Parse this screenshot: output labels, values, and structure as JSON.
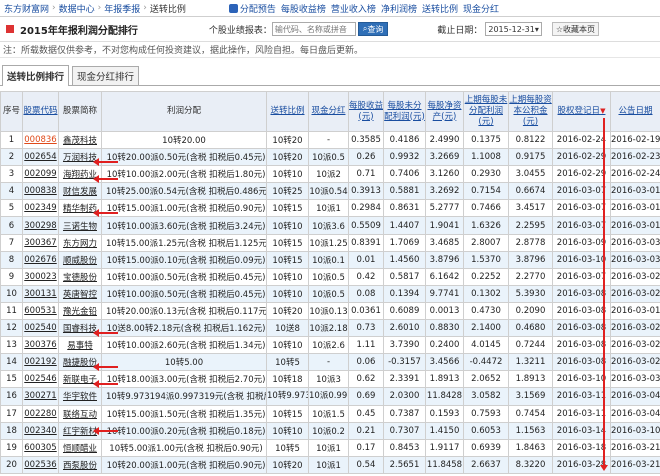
{
  "topnav": {
    "crumbs": [
      "东方财富网",
      "数据中心",
      "年报季报",
      "送转比例"
    ],
    "links": [
      "分配预告",
      "每股收益榜",
      "营业收入榜",
      "净利润榜",
      "送转比例",
      "现金分红"
    ]
  },
  "titlebar": {
    "title": "2015年年报利润分配排行",
    "query_label": "个股业绩报表：",
    "query_placeholder": "输代码、名称或拼音",
    "query_button": "查询",
    "date_label": "截止日期：",
    "date_value": "2015-12-31",
    "favorite": "收藏本页"
  },
  "notice": "注：所载数据仅供参考，不对您构成任何投资建议，据此操作，风险自担。每日盘后更新。",
  "tabs": [
    "送转比例排行",
    "现金分红排行"
  ],
  "table": {
    "headers": [
      "序号",
      "股票代码",
      "股票简称",
      "利润分配",
      "送转比例",
      "现金分红",
      "每股收益(元)",
      "每股未分配利润(元)",
      "每股净资产(元)",
      "上期每股未分配利润(元)",
      "上期每股资本公积金(元)",
      "股权登记日",
      "公告日期"
    ],
    "rows": [
      [
        "1",
        "000836",
        "鑫茂科技",
        "10转20.00",
        "10转20",
        "-",
        "0.3585",
        "0.4186",
        "2.4990",
        "0.1375",
        "0.8122",
        "2016-02-24",
        "2016-02-19"
      ],
      [
        "2",
        "002654",
        "万润科技",
        "10转20.00派0.50元(含税 扣税后0.45元)",
        "10转20",
        "10派0.5",
        "0.26",
        "0.9932",
        "3.2669",
        "1.1008",
        "0.9175",
        "2016-02-29",
        "2016-02-23"
      ],
      [
        "3",
        "002099",
        "海翔药业",
        "10转10.00派2.00元(含税 扣税后1.80元)",
        "10转10",
        "10派2",
        "0.71",
        "0.7406",
        "3.1260",
        "0.2930",
        "3.0455",
        "2016-02-29",
        "2016-02-24"
      ],
      [
        "4",
        "000838",
        "财信发展",
        "10转25.00派0.54元(含税 扣税后0.486元)",
        "10转25",
        "10派0.54",
        "0.3913",
        "0.5881",
        "3.2692",
        "0.7154",
        "0.6674",
        "2016-03-07",
        "2016-03-01"
      ],
      [
        "5",
        "002349",
        "精华制药",
        "10转15.00派1.00元(含税 扣税后0.90元)",
        "10转15",
        "10派1",
        "0.2984",
        "0.8631",
        "5.2777",
        "0.7466",
        "3.4517",
        "2016-03-07",
        "2016-03-01"
      ],
      [
        "6",
        "300298",
        "三诺生物",
        "10转10.00派3.60元(含税 扣税后3.24元)",
        "10转10",
        "10派3.6",
        "0.5509",
        "1.4407",
        "1.9041",
        "1.6326",
        "2.2595",
        "2016-03-07",
        "2016-03-01"
      ],
      [
        "7",
        "300367",
        "东方网力",
        "10转15.00派1.25元(含税 扣税后1.125元)",
        "10转15",
        "10派1.25",
        "0.8391",
        "1.7069",
        "3.4685",
        "2.8007",
        "2.8778",
        "2016-03-09",
        "2016-03-03"
      ],
      [
        "8",
        "002676",
        "顺威股份",
        "10转15.00派0.10元(含税 扣税后0.09元)",
        "10转15",
        "10派0.1",
        "0.01",
        "1.4560",
        "3.8796",
        "1.5370",
        "3.8796",
        "2016-03-10",
        "2016-03-03"
      ],
      [
        "9",
        "300023",
        "宝德股份",
        "10转10.00派0.50元(含税 扣税后0.45元)",
        "10转10",
        "10派0.5",
        "0.42",
        "0.5817",
        "6.1642",
        "0.2252",
        "2.2770",
        "2016-03-07",
        "2016-03-02"
      ],
      [
        "10",
        "300131",
        "英唐智控",
        "10转10.00派0.50元(含税 扣税后0.45元)",
        "10转10",
        "10派0.5",
        "0.08",
        "0.1394",
        "9.7741",
        "0.1302",
        "5.3930",
        "2016-03-08",
        "2016-03-02"
      ],
      [
        "11",
        "600531",
        "豫光金铅",
        "10转20.00派0.13元(含税 扣税后0.117元)",
        "10转20",
        "10派0.13",
        "0.0361",
        "0.6089",
        "0.0013",
        "0.4730",
        "0.2090",
        "2016-03-08",
        "2016-03-01"
      ],
      [
        "12",
        "002540",
        "国睿科技",
        "10送8.00转2.18元(含税 扣税后1.162元)",
        "10送8",
        "10派2.18",
        "0.73",
        "2.6010",
        "0.8830",
        "2.1400",
        "0.4680",
        "2016-03-08",
        "2016-03-02"
      ],
      [
        "13",
        "300376",
        "易事特",
        "10转10.00派2.60元(含税 扣税后1.34元)",
        "10转10",
        "10派2.6",
        "1.11",
        "3.7390",
        "0.2400",
        "4.0145",
        "0.7244",
        "2016-03-08",
        "2016-03-02"
      ],
      [
        "14",
        "002192",
        "融捷股份",
        "10转5.00",
        "10转5",
        "-",
        "0.06",
        "-0.3157",
        "3.4566",
        "-0.4472",
        "1.3211",
        "2016-03-08",
        "2016-03-02"
      ],
      [
        "15",
        "002546",
        "新联电子",
        "10转18.00派3.00元(含税 扣税后2.70元)",
        "10转18",
        "10派3",
        "0.62",
        "2.3391",
        "1.8913",
        "2.0652",
        "1.8913",
        "2016-03-10",
        "2016-03-03"
      ],
      [
        "16",
        "300271",
        "华宇软件",
        "10转9.973194派0.997319元(含税 扣税后0.897587元)",
        "10转9.973194",
        "10派0.997319",
        "0.69",
        "2.0300",
        "11.8428",
        "3.0582",
        "3.1569",
        "2016-03-11",
        "2016-03-04"
      ],
      [
        "17",
        "002280",
        "联络互动",
        "10转15.00派1.50元(含税 扣税后1.35元)",
        "10转15",
        "10派1.5",
        "0.45",
        "0.7387",
        "0.1593",
        "0.7593",
        "0.7454",
        "2016-03-11",
        "2016-03-04"
      ],
      [
        "18",
        "002340",
        "红宇新材",
        "10转10.00派0.20元(含税 扣税后0.18元)",
        "10转10",
        "10派0.2",
        "0.21",
        "0.7307",
        "1.4150",
        "0.6053",
        "1.1563",
        "2016-03-14",
        "2016-03-10"
      ],
      [
        "19",
        "600305",
        "恒顺醋业",
        "10转5.00派1.00元(含税 扣税后0.90元)",
        "10转5",
        "10派1",
        "0.17",
        "0.8453",
        "1.9117",
        "0.6939",
        "1.8463",
        "2016-03-18",
        "2016-03-21"
      ],
      [
        "20",
        "002536",
        "西泵股份",
        "10转20.00派1.00元(含税 扣税后0.90元)",
        "10转20",
        "10派1",
        "0.54",
        "2.5651",
        "11.8458",
        "2.6637",
        "8.3220",
        "2016-03-28",
        "2016-03-21"
      ]
    ]
  },
  "colors": {
    "link": "#1a4ea0",
    "highlight_code": "#e04a1a",
    "arrow": "#e02020",
    "header_bg": "#e9eef6",
    "even_row": "#eaf3fb"
  }
}
